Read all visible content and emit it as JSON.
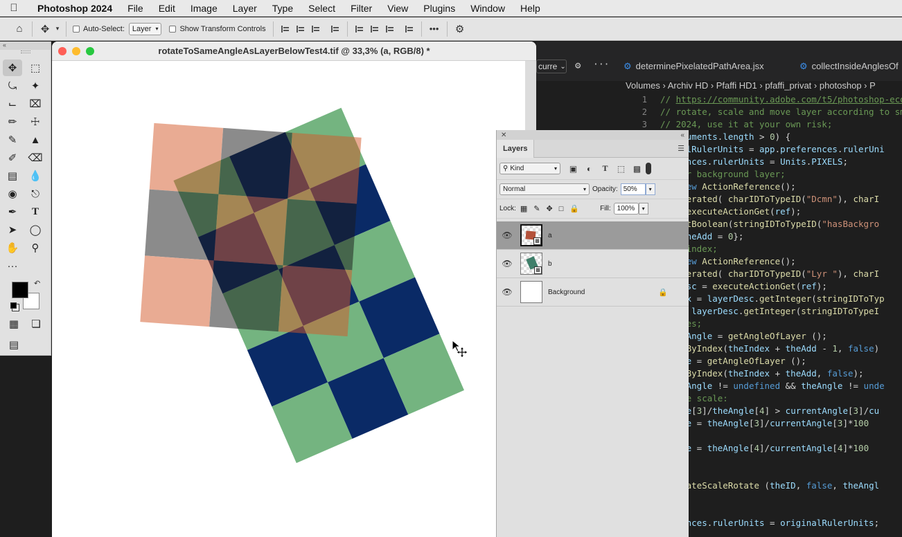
{
  "menubar": {
    "app_name": "Photoshop 2024",
    "items": [
      "File",
      "Edit",
      "Image",
      "Layer",
      "Type",
      "Select",
      "Filter",
      "View",
      "Plugins",
      "Window",
      "Help"
    ]
  },
  "options": {
    "auto_select_label": "Auto-Select:",
    "auto_select_value": "Layer",
    "transform_controls_label": "Show Transform Controls",
    "more_label": "•••"
  },
  "document": {
    "title": "rotateToSameAngleAsLayerBelowTest4.tif @ 33,3% (a, RGB/8) *"
  },
  "layers_panel": {
    "tab_label": "Layers",
    "filter_kind": "Kind",
    "blend_mode": "Normal",
    "opacity_label": "Opacity:",
    "opacity_value": "50%",
    "lock_label": "Lock:",
    "fill_label": "Fill:",
    "fill_value": "100%",
    "layers": [
      {
        "name": "a",
        "selected": true
      },
      {
        "name": "b",
        "selected": false
      },
      {
        "name": "Background",
        "selected": false,
        "locked": true
      }
    ]
  },
  "editor": {
    "dropdown_value": "curre",
    "tabs": [
      "determinePixelatedPathArea.jsx",
      "collectInsideAnglesOf"
    ],
    "breadcrumbs": "Volumes  ›  Archiv HD  ›  Pfaffi HD1  ›  pfaffi_privat  ›  photoshop  ›  P",
    "line_numbers": [
      "1",
      "2",
      "3"
    ]
  },
  "colors": {
    "salmon": "#e8a98c",
    "gray": "#6a6a6a",
    "green": "#74b480",
    "navy": "#0a2a66",
    "accent_blue": "#3b8eea"
  }
}
